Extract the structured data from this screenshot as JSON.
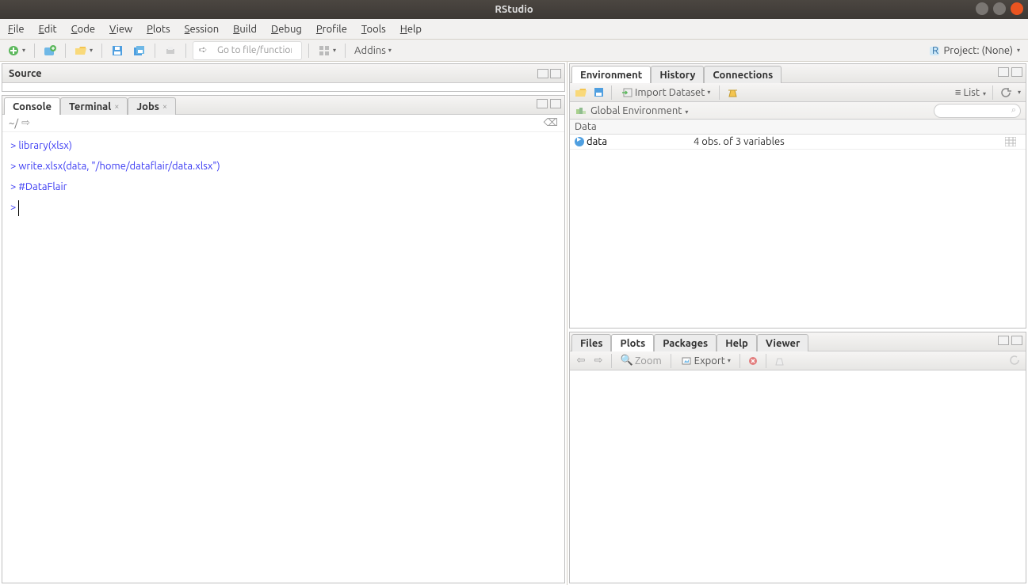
{
  "window": {
    "title": "RStudio"
  },
  "menu": [
    "File",
    "Edit",
    "Code",
    "View",
    "Plots",
    "Session",
    "Build",
    "Debug",
    "Profile",
    "Tools",
    "Help"
  ],
  "toolbar": {
    "goto_placeholder": "Go to file/function",
    "addins": "Addins",
    "project_label": "Project: (None)"
  },
  "left": {
    "source": {
      "title": "Source"
    },
    "console": {
      "tabs": [
        "Console",
        "Terminal",
        "Jobs"
      ],
      "path": "~/",
      "lines": [
        {
          "prompt": ">",
          "text": "library(xlsx)"
        },
        {
          "prompt": ">",
          "text": "write.xlsx(data, \"/home/dataflair/data.xlsx\")"
        },
        {
          "prompt": ">",
          "text": "#DataFlair"
        },
        {
          "prompt": ">",
          "text": ""
        }
      ]
    }
  },
  "env": {
    "tabs": [
      "Environment",
      "History",
      "Connections"
    ],
    "import_label": "Import Dataset",
    "view_mode": "List",
    "scope": "Global Environment",
    "section": "Data",
    "items": [
      {
        "name": "data",
        "desc": "4 obs. of  3 variables"
      }
    ]
  },
  "plots": {
    "tabs": [
      "Files",
      "Plots",
      "Packages",
      "Help",
      "Viewer"
    ],
    "zoom": "Zoom",
    "export": "Export"
  }
}
